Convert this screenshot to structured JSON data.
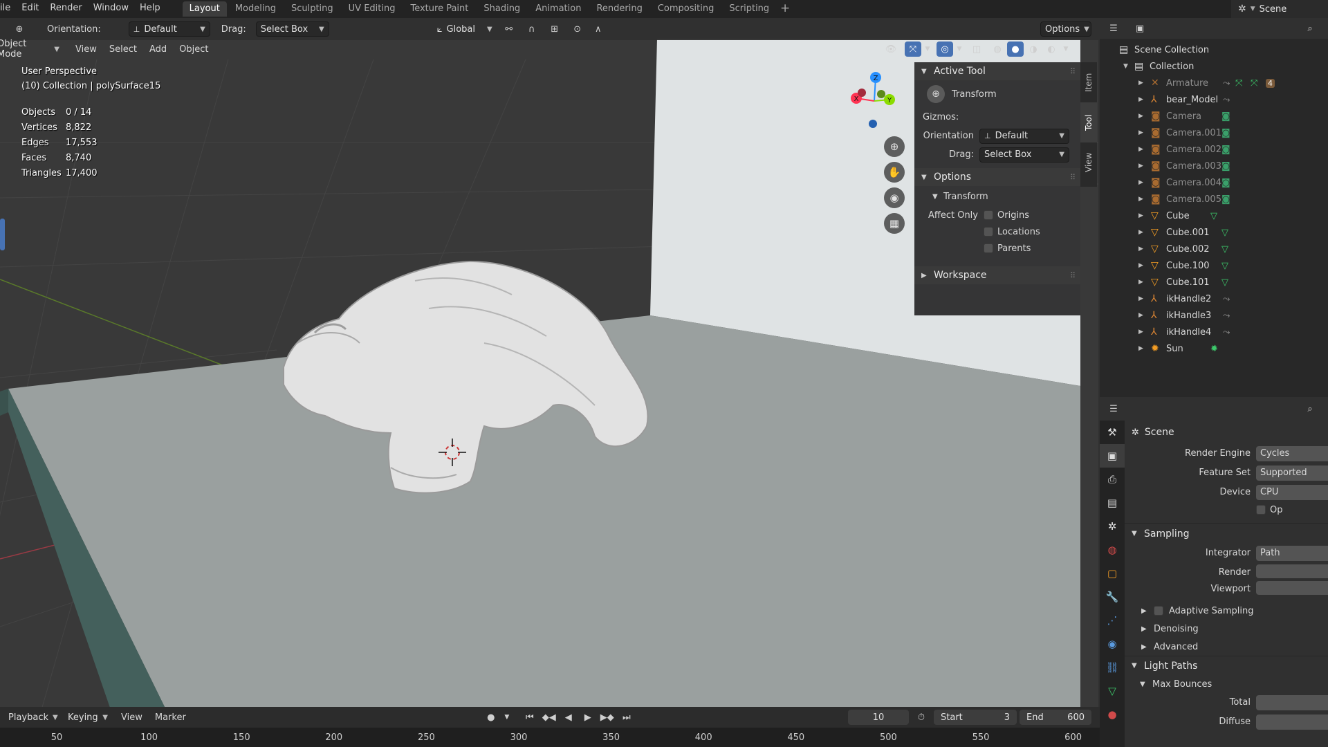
{
  "menu": [
    "ile",
    "Edit",
    "Render",
    "Window",
    "Help"
  ],
  "workspaces": [
    "Layout",
    "Modeling",
    "Sculpting",
    "UV Editing",
    "Texture Paint",
    "Shading",
    "Animation",
    "Rendering",
    "Compositing",
    "Scripting"
  ],
  "workspace_active": "Layout",
  "scene_name": "Scene",
  "tool_header": {
    "orientation_label": "Orientation:",
    "orientation_value": "Default",
    "drag_label": "Drag:",
    "drag_value": "Select Box",
    "transform_space": "Global",
    "options_label": "Options"
  },
  "vp_header": {
    "mode": "Object Mode",
    "items": [
      "View",
      "Select",
      "Add",
      "Object"
    ]
  },
  "overlay": {
    "view_name": "User Perspective",
    "context": "(10) Collection | polySurface15"
  },
  "stats": [
    {
      "k": "Objects",
      "v": "0 / 14"
    },
    {
      "k": "Vertices",
      "v": "8,822"
    },
    {
      "k": "Edges",
      "v": "17,553"
    },
    {
      "k": "Faces",
      "v": "8,740"
    },
    {
      "k": "Triangles",
      "v": "17,400"
    }
  ],
  "gizmo_axes": {
    "z": "Z",
    "x": "X",
    "y": "Y"
  },
  "n_panel": {
    "tabs": [
      "Item",
      "Tool",
      "View"
    ],
    "active_tool_title": "Active Tool",
    "tool_name": "Transform",
    "gizmos_label": "Gizmos:",
    "orientation_label": "Orientation",
    "orientation_value": "Default",
    "drag_label": "Drag:",
    "drag_value": "Select Box",
    "options_title": "Options",
    "transform_sub": "Transform",
    "affect_only": "Affect Only",
    "checks": [
      "Origins",
      "Locations",
      "Parents"
    ],
    "workspace_title": "Workspace"
  },
  "outliner": {
    "root": "Scene Collection",
    "collection": "Collection",
    "items": [
      {
        "name": "Armature",
        "icon": "armature-icon",
        "dim": true
      },
      {
        "name": "bear_Model",
        "icon": "empty-icon",
        "dim": false
      },
      {
        "name": "Camera",
        "icon": "camera-icon",
        "dim": true
      },
      {
        "name": "Camera.001",
        "icon": "camera-icon",
        "dim": true
      },
      {
        "name": "Camera.002",
        "icon": "camera-icon",
        "dim": true
      },
      {
        "name": "Camera.003",
        "icon": "camera-icon",
        "dim": true
      },
      {
        "name": "Camera.004",
        "icon": "camera-icon",
        "dim": true
      },
      {
        "name": "Camera.005",
        "icon": "camera-icon",
        "dim": true
      },
      {
        "name": "Cube",
        "icon": "mesh-icon",
        "dim": false
      },
      {
        "name": "Cube.001",
        "icon": "mesh-icon",
        "dim": false
      },
      {
        "name": "Cube.002",
        "icon": "mesh-icon",
        "dim": false
      },
      {
        "name": "Cube.100",
        "icon": "mesh-icon",
        "dim": false
      },
      {
        "name": "Cube.101",
        "icon": "mesh-icon",
        "dim": false
      },
      {
        "name": "ikHandle2",
        "icon": "empty-icon",
        "dim": false
      },
      {
        "name": "ikHandle3",
        "icon": "empty-icon",
        "dim": false
      },
      {
        "name": "ikHandle4",
        "icon": "empty-icon",
        "dim": false
      },
      {
        "name": "Sun",
        "icon": "light-icon",
        "dim": false
      }
    ],
    "armature_badge": "4"
  },
  "properties": {
    "context": "Scene",
    "render_engine_label": "Render Engine",
    "render_engine_value": "Cycles",
    "feature_set_label": "Feature Set",
    "feature_set_value": "Supported",
    "device_label": "Device",
    "device_value": "CPU",
    "op_label": "Op",
    "sampling": "Sampling",
    "integrator_label": "Integrator",
    "integrator_value": "Path",
    "render_label": "Render",
    "viewport_label": "Viewport",
    "adaptive_sampling": "Adaptive Sampling",
    "denoising": "Denoising",
    "advanced": "Advanced",
    "light_paths": "Light Paths",
    "max_bounces": "Max Bounces",
    "total_label": "Total",
    "diffuse_label": "Diffuse"
  },
  "timeline": {
    "menus": [
      "Playback",
      "Keying",
      "View",
      "Marker"
    ],
    "current_frame": "10",
    "start_label": "Start",
    "start_value": "3",
    "end_label": "End",
    "end_value": "600",
    "ticks": [
      "50",
      "100",
      "150",
      "200",
      "250",
      "300",
      "350",
      "400",
      "450",
      "500",
      "550",
      "600"
    ]
  },
  "colors": {
    "accent": "#4772b3",
    "axis_x": "#ff3352",
    "axis_y": "#8bdc00",
    "axis_z": "#2890ff",
    "mesh_icon": "#f29c24",
    "object_orange": "#e08834"
  }
}
